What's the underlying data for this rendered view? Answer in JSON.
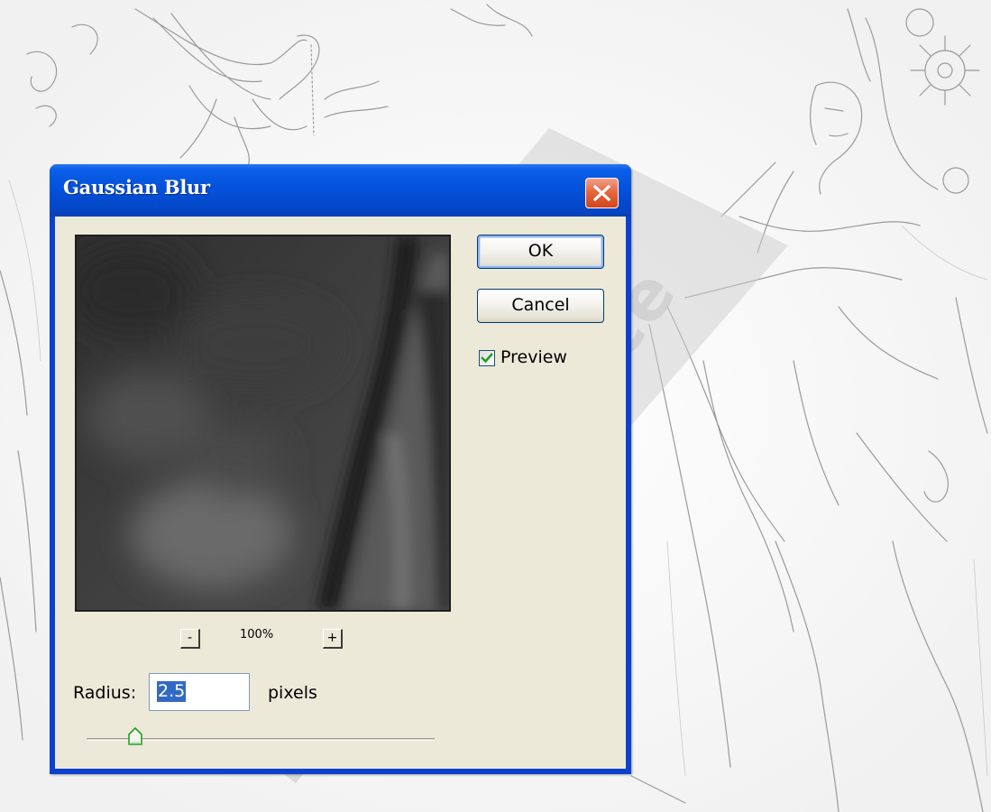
{
  "watermark": {
    "text": "Tutorials Palace"
  },
  "dialog": {
    "title": "Gaussian Blur",
    "ok_label": "OK",
    "cancel_label": "Cancel",
    "preview_label": "Preview",
    "preview_checked": true,
    "zoom": {
      "minus_label": "-",
      "plus_label": "+",
      "level": "100%"
    },
    "radius": {
      "label": "Radius:",
      "value": "2.5",
      "units": "pixels"
    },
    "icons": {
      "close": "close-icon",
      "checkmark": "checkmark-icon",
      "slider_thumb": "slider-thumb-icon"
    },
    "colors": {
      "titlebar": "#0350d8",
      "client": "#ece9d8",
      "close_button": "#e5693f",
      "selection": "#316ac5",
      "checkmark": "#21a121"
    }
  }
}
